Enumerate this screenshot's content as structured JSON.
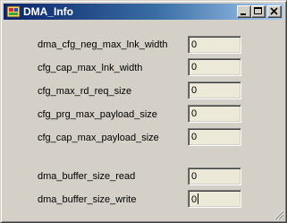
{
  "window": {
    "title": "DMA_Info"
  },
  "fields": [
    {
      "label": "dma_cfg_neg_max_lnk_width",
      "value": "0"
    },
    {
      "label": "cfg_cap_max_lnk_width",
      "value": "0"
    },
    {
      "label": "cfg_max_rd_req_size",
      "value": "0"
    },
    {
      "label": "cfg_prg_max_payload_size",
      "value": "0"
    },
    {
      "label": "cfg_cap_max_payload_size",
      "value": "0"
    },
    {
      "label": "dma_buffer_size_read",
      "value": "0"
    },
    {
      "label": "dma_buffer_size_write",
      "value": "0"
    }
  ],
  "colors": {
    "title_bar_start": "#0a246a",
    "title_bar_end": "#a6caf0",
    "face": "#d4d0c8",
    "field_bg": "#ece9d8"
  },
  "icons": [
    "app-icon",
    "minimize-icon",
    "maximize-icon",
    "close-icon",
    "resize-grip-icon"
  ]
}
